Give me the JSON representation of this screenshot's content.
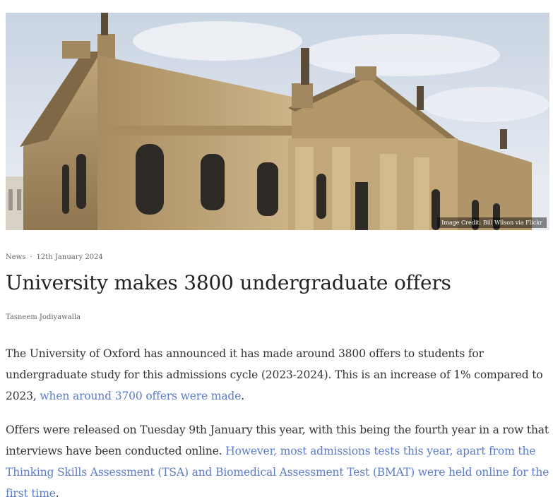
{
  "hero": {
    "image_credit": "Image Credit: Bill Wilson via Flickr"
  },
  "article": {
    "category": "News",
    "separator": "·",
    "date": "12th January 2024",
    "title": "University makes 3800 undergraduate offers",
    "author": "Tasneem Jodiyawalla",
    "paragraph1": {
      "text": "The University of Oxford has announced it has made around 3800 offers to students for undergraduate study for this admissions cycle (2023-2024). This is an increase of 1% compared to 2023, ",
      "link": "when around 3700 offers were made",
      "end": "."
    },
    "paragraph2": {
      "text": "Offers were released on Tuesday 9th January this year, with this being the fourth year in a row that interviews have been conducted online. ",
      "link": "However, most admissions tests this year, apart from the Thinking Skills Assessment (TSA) and Biomedical Assessment Test (BMAT) were held online for the first time",
      "end": "."
    }
  },
  "colors": {
    "link": "#5b7cc9",
    "body_text": "#333333",
    "meta_text": "#666666"
  }
}
